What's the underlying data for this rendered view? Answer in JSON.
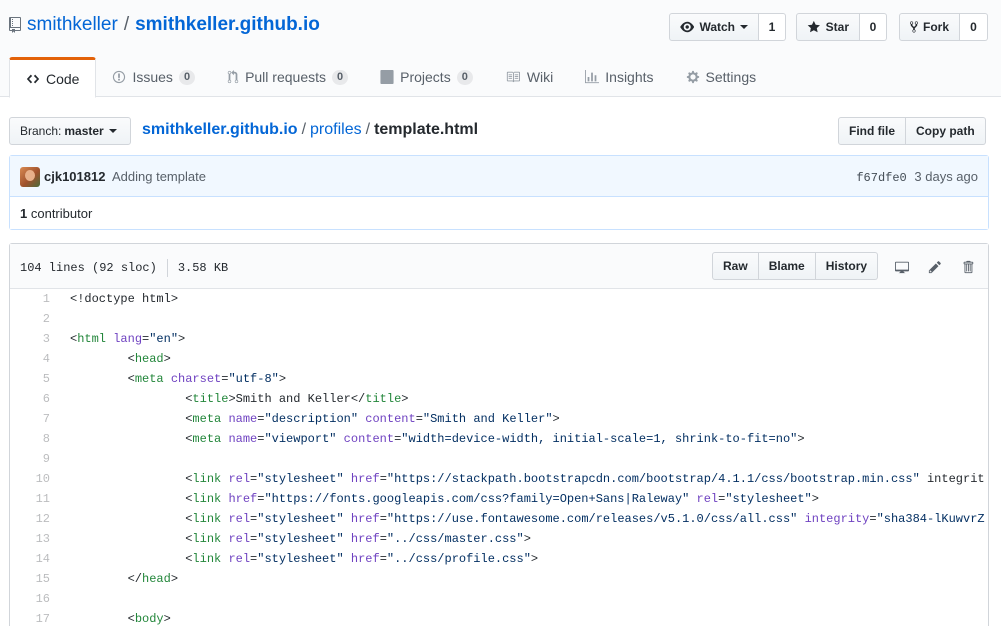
{
  "repo": {
    "owner": "smithkeller",
    "separator": "/",
    "name": "smithkeller.github.io"
  },
  "actions": {
    "watch": {
      "label": "Watch",
      "count": "1"
    },
    "star": {
      "label": "Star",
      "count": "0"
    },
    "fork": {
      "label": "Fork",
      "count": "0"
    }
  },
  "tabs": [
    {
      "label": "Code"
    },
    {
      "label": "Issues",
      "badge": "0"
    },
    {
      "label": "Pull requests",
      "badge": "0"
    },
    {
      "label": "Projects",
      "badge": "0"
    },
    {
      "label": "Wiki"
    },
    {
      "label": "Insights"
    },
    {
      "label": "Settings"
    }
  ],
  "branch": {
    "prefix": "Branch:",
    "name": "master"
  },
  "breadcrumb": {
    "root": "smithkeller.github.io",
    "folder": "profiles",
    "file": "template.html",
    "sep": "/"
  },
  "file_buttons": {
    "find": "Find file",
    "copy": "Copy path"
  },
  "commit": {
    "author": "cjk101812",
    "message": "Adding template",
    "sha": "f67dfe0",
    "time": "3 days ago"
  },
  "contributors": {
    "count": "1",
    "label": "contributor"
  },
  "file": {
    "lines_info": "104 lines (92 sloc)",
    "size": "3.58 KB",
    "raw": "Raw",
    "blame": "Blame",
    "history": "History"
  },
  "code_lines": [
    "<!doctype html>",
    "",
    "<html lang=\"en\">",
    "        <head>",
    "        <meta charset=\"utf-8\">",
    "                <title>Smith and Keller</title>",
    "                <meta name=\"description\" content=\"Smith and Keller\">",
    "                <meta name=\"viewport\" content=\"width=device-width, initial-scale=1, shrink-to-fit=no\">",
    "",
    "                <link rel=\"stylesheet\" href=\"https://stackpath.bootstrapcdn.com/bootstrap/4.1.1/css/bootstrap.min.css\" integrit",
    "                <link href=\"https://fonts.googleapis.com/css?family=Open+Sans|Raleway\" rel=\"stylesheet\">",
    "                <link rel=\"stylesheet\" href=\"https://use.fontawesome.com/releases/v5.1.0/css/all.css\" integrity=\"sha384-lKuwvrZ",
    "                <link rel=\"stylesheet\" href=\"../css/master.css\">",
    "                <link rel=\"stylesheet\" href=\"../css/profile.css\">",
    "        </head>",
    "",
    "        <body>"
  ]
}
